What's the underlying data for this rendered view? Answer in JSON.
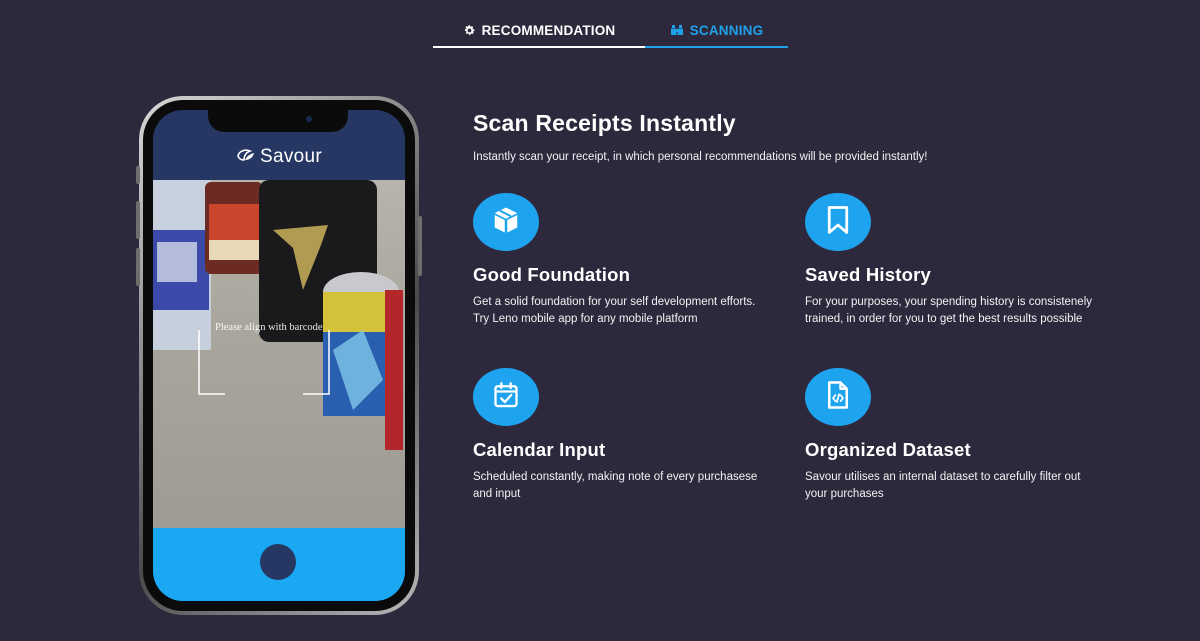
{
  "tabs": {
    "recommendation": {
      "label": "RECOMMENDATION",
      "icon": "gear-icon"
    },
    "scanning": {
      "label": "SCANNING",
      "icon": "binoculars-icon",
      "active": true
    }
  },
  "phone": {
    "app_name": "Savour",
    "camera_hint": "Please align with barcode"
  },
  "content": {
    "title": "Scan Receipts Instantly",
    "subtitle": "Instantly scan your receipt, in which personal recommendations will be provided instantly!",
    "features": [
      {
        "icon": "box-icon",
        "title": "Good Foundation",
        "description": "Get a solid foundation for your self development efforts. Try Leno mobile app for any mobile platform"
      },
      {
        "icon": "bookmark-icon",
        "title": "Saved History",
        "description": "For your purposes, your spending history is consistenely trained, in order for you to get the best results possible"
      },
      {
        "icon": "calendar-check-icon",
        "title": "Calendar Input",
        "description": "Scheduled constantly, making note of every purchasese and input"
      },
      {
        "icon": "file-code-icon",
        "title": "Organized Dataset",
        "description": "Savour utilises an internal dataset to carefully filter out your purchases"
      }
    ]
  },
  "colors": {
    "background": "#2e283c",
    "accent": "#1ea4ee",
    "app_header": "#273763"
  }
}
